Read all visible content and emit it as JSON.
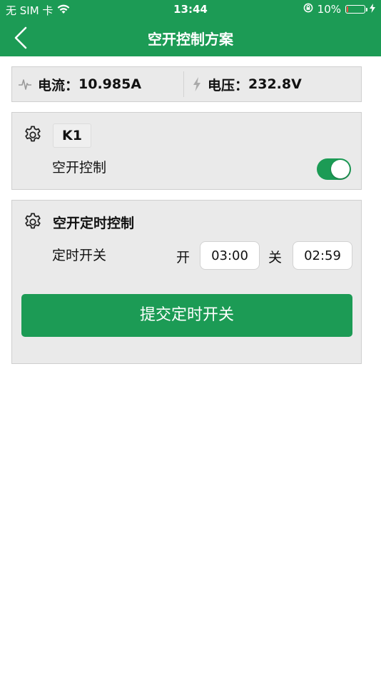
{
  "status_bar": {
    "carrier": "无 SIM 卡",
    "time": "13:44",
    "battery_percent": "10%",
    "battery_level": 0.1
  },
  "nav": {
    "title": "空开控制方案"
  },
  "info": {
    "current_label": "电流：",
    "current_value": "10.985A",
    "voltage_label": "电压：",
    "voltage_value": "232.8V"
  },
  "switch_card": {
    "name": "K1",
    "control_label": "空开控制",
    "control_on": true
  },
  "timer_card": {
    "title": "空开定时控制",
    "row_label": "定时开关",
    "on_label": "开",
    "on_time": "03:00",
    "off_label": "关",
    "off_time": "02:59",
    "submit_label": "提交定时开关"
  },
  "colors": {
    "brand_green": "#1c9b55",
    "battery_low": "#ff4a3d",
    "card_bg": "#eaeaea"
  },
  "icons": [
    "wifi-icon",
    "orientation-lock-icon",
    "battery-icon",
    "charging-icon",
    "back-chevron-icon",
    "waveform-icon",
    "lightning-icon",
    "gear-icon"
  ]
}
